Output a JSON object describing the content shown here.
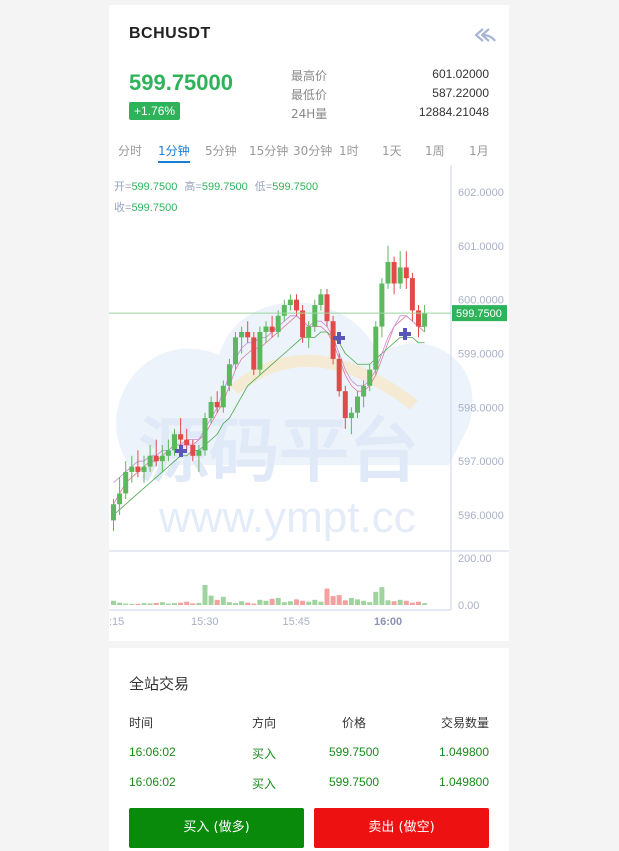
{
  "header": {
    "symbol": "BCHUSDT",
    "price": "599.75000",
    "change_pct": "+1.76%",
    "stats": [
      {
        "label": "最高价",
        "value": "601.02000"
      },
      {
        "label": "最低价",
        "value": "587.22000"
      },
      {
        "label": "24H量",
        "value": "12884.21048"
      }
    ]
  },
  "tabs": [
    {
      "label": "分时",
      "active": false
    },
    {
      "label": "1分钟",
      "active": true
    },
    {
      "label": "5分钟",
      "active": false
    },
    {
      "label": "15分钟",
      "active": false
    },
    {
      "label": "30分钟",
      "active": false
    },
    {
      "label": "1时",
      "active": false
    },
    {
      "label": "1天",
      "active": false
    },
    {
      "label": "1周",
      "active": false
    },
    {
      "label": "1月",
      "active": false
    }
  ],
  "ohlc": {
    "open_label": "开=",
    "open_value": "599.7500",
    "high_label": "高=",
    "high_value": "599.7500",
    "low_label": "低=",
    "low_value": "599.7500",
    "close_label": "收=",
    "close_value": "599.7500"
  },
  "watermark": {
    "line1": "源码平台",
    "line2": "www.ympt.cc"
  },
  "chart_data": {
    "type": "candlestick",
    "price_ticks": [
      "602.0000",
      "601.0000",
      "600.0000",
      "599.0000",
      "598.0000",
      "597.0000",
      "596.0000"
    ],
    "price_tick_values": [
      602,
      601,
      600,
      599,
      598,
      597,
      596
    ],
    "current_price_label": "599.7500",
    "current_price": 599.75,
    "volume_ticks": [
      "200.00",
      "0.00"
    ],
    "volume_tick_values": [
      200,
      0
    ],
    "time_ticks": [
      ":15",
      "15:30",
      "15:45",
      "16:00"
    ],
    "time_tick_index": [
      0,
      15,
      30,
      45
    ],
    "colors": {
      "up": "#5cb85c",
      "down": "#e24a4a",
      "vol_up": "#9fd49f",
      "vol_down": "#f2a0a0"
    },
    "candles": [
      {
        "o": 595.9,
        "h": 596.3,
        "l": 595.7,
        "c": 596.2
      },
      {
        "o": 596.2,
        "h": 596.7,
        "l": 596.0,
        "c": 596.4
      },
      {
        "o": 596.4,
        "h": 597.0,
        "l": 596.3,
        "c": 596.8
      },
      {
        "o": 596.8,
        "h": 597.1,
        "l": 596.6,
        "c": 596.9
      },
      {
        "o": 596.9,
        "h": 597.2,
        "l": 596.7,
        "c": 596.8
      },
      {
        "o": 596.8,
        "h": 597.1,
        "l": 596.6,
        "c": 596.9
      },
      {
        "o": 596.9,
        "h": 597.3,
        "l": 596.8,
        "c": 597.1
      },
      {
        "o": 597.1,
        "h": 597.4,
        "l": 596.9,
        "c": 597.0
      },
      {
        "o": 597.0,
        "h": 597.3,
        "l": 596.8,
        "c": 597.1
      },
      {
        "o": 597.1,
        "h": 597.4,
        "l": 597.0,
        "c": 597.2
      },
      {
        "o": 597.2,
        "h": 597.6,
        "l": 597.1,
        "c": 597.5
      },
      {
        "o": 597.5,
        "h": 597.8,
        "l": 597.3,
        "c": 597.4
      },
      {
        "o": 597.4,
        "h": 597.6,
        "l": 597.2,
        "c": 597.3
      },
      {
        "o": 597.3,
        "h": 597.4,
        "l": 597.0,
        "c": 597.1
      },
      {
        "o": 597.1,
        "h": 597.3,
        "l": 596.8,
        "c": 597.2
      },
      {
        "o": 597.2,
        "h": 597.9,
        "l": 597.1,
        "c": 597.8
      },
      {
        "o": 597.8,
        "h": 598.2,
        "l": 597.7,
        "c": 598.1
      },
      {
        "o": 598.1,
        "h": 598.3,
        "l": 597.9,
        "c": 598.0
      },
      {
        "o": 598.0,
        "h": 598.5,
        "l": 597.9,
        "c": 598.4
      },
      {
        "o": 598.4,
        "h": 598.9,
        "l": 598.3,
        "c": 598.8
      },
      {
        "o": 598.8,
        "h": 599.4,
        "l": 598.7,
        "c": 599.3
      },
      {
        "o": 599.3,
        "h": 599.5,
        "l": 599.0,
        "c": 599.4
      },
      {
        "o": 599.4,
        "h": 599.6,
        "l": 599.2,
        "c": 599.3
      },
      {
        "o": 599.3,
        "h": 599.4,
        "l": 598.6,
        "c": 598.7
      },
      {
        "o": 598.7,
        "h": 599.5,
        "l": 598.6,
        "c": 599.4
      },
      {
        "o": 599.4,
        "h": 599.6,
        "l": 599.2,
        "c": 599.5
      },
      {
        "o": 599.5,
        "h": 599.7,
        "l": 599.3,
        "c": 599.4
      },
      {
        "o": 599.4,
        "h": 599.8,
        "l": 599.3,
        "c": 599.7
      },
      {
        "o": 599.7,
        "h": 600.0,
        "l": 599.6,
        "c": 599.9
      },
      {
        "o": 599.9,
        "h": 600.1,
        "l": 599.8,
        "c": 600.0
      },
      {
        "o": 600.0,
        "h": 600.1,
        "l": 599.7,
        "c": 599.8
      },
      {
        "o": 599.8,
        "h": 599.9,
        "l": 599.2,
        "c": 599.3
      },
      {
        "o": 599.3,
        "h": 599.6,
        "l": 599.1,
        "c": 599.5
      },
      {
        "o": 599.5,
        "h": 600.0,
        "l": 599.4,
        "c": 599.9
      },
      {
        "o": 599.9,
        "h": 600.2,
        "l": 599.8,
        "c": 600.1
      },
      {
        "o": 600.1,
        "h": 600.2,
        "l": 599.5,
        "c": 599.6
      },
      {
        "o": 599.6,
        "h": 599.7,
        "l": 598.8,
        "c": 598.9
      },
      {
        "o": 598.9,
        "h": 599.0,
        "l": 598.2,
        "c": 598.3
      },
      {
        "o": 598.3,
        "h": 598.4,
        "l": 597.6,
        "c": 597.8
      },
      {
        "o": 597.8,
        "h": 598.0,
        "l": 597.5,
        "c": 597.9
      },
      {
        "o": 597.9,
        "h": 598.3,
        "l": 597.8,
        "c": 598.2
      },
      {
        "o": 598.2,
        "h": 598.5,
        "l": 598.0,
        "c": 598.4
      },
      {
        "o": 598.4,
        "h": 598.8,
        "l": 598.3,
        "c": 598.7
      },
      {
        "o": 598.7,
        "h": 599.6,
        "l": 598.6,
        "c": 599.5
      },
      {
        "o": 599.5,
        "h": 600.4,
        "l": 599.3,
        "c": 600.3
      },
      {
        "o": 600.3,
        "h": 601.0,
        "l": 600.2,
        "c": 600.7
      },
      {
        "o": 600.7,
        "h": 600.8,
        "l": 600.1,
        "c": 600.3
      },
      {
        "o": 600.3,
        "h": 600.9,
        "l": 600.2,
        "c": 600.6
      },
      {
        "o": 600.6,
        "h": 600.9,
        "l": 600.2,
        "c": 600.4
      },
      {
        "o": 600.4,
        "h": 600.5,
        "l": 599.6,
        "c": 599.8
      },
      {
        "o": 599.8,
        "h": 599.9,
        "l": 599.3,
        "c": 599.5
      },
      {
        "o": 599.5,
        "h": 599.9,
        "l": 599.4,
        "c": 599.75
      }
    ],
    "volumes": [
      18,
      10,
      6,
      4,
      5,
      8,
      7,
      9,
      12,
      6,
      8,
      10,
      14,
      7,
      9,
      85,
      40,
      22,
      35,
      12,
      8,
      16,
      10,
      6,
      22,
      18,
      26,
      30,
      12,
      16,
      24,
      18,
      14,
      22,
      14,
      70,
      38,
      42,
      20,
      30,
      24,
      18,
      12,
      56,
      76,
      20,
      16,
      22,
      18,
      10,
      14,
      8
    ],
    "ma_fast": [
      596.2,
      596.4,
      596.6,
      596.7,
      596.8,
      596.9,
      597.0,
      597.0,
      597.1,
      597.2,
      597.3,
      597.3,
      597.3,
      597.3,
      597.4,
      597.5,
      597.7,
      597.9,
      598.1,
      598.4,
      598.7,
      598.9,
      599.0,
      599.1,
      599.1,
      599.2,
      599.3,
      599.4,
      599.5,
      599.6,
      599.7,
      599.6,
      599.5,
      599.5,
      599.5,
      599.4,
      599.2,
      598.9,
      598.6,
      598.4,
      598.3,
      598.3,
      598.4,
      598.6,
      598.9,
      599.2,
      599.5,
      599.6,
      599.7,
      599.6,
      599.5,
      599.4
    ],
    "ma_slow": [
      596.0,
      596.1,
      596.2,
      596.3,
      596.4,
      596.5,
      596.6,
      596.7,
      596.8,
      596.9,
      597.0,
      597.1,
      597.1,
      597.2,
      597.2,
      597.3,
      597.4,
      597.5,
      597.7,
      597.8,
      598.0,
      598.2,
      598.4,
      598.5,
      598.6,
      598.7,
      598.8,
      598.9,
      599.0,
      599.1,
      599.2,
      599.3,
      599.3,
      599.3,
      599.4,
      599.4,
      599.3,
      599.2,
      599.0,
      598.9,
      598.8,
      598.8,
      598.8,
      598.9,
      599.0,
      599.1,
      599.2,
      599.3,
      599.3,
      599.3,
      599.2,
      599.2
    ],
    "ma_alt": [
      596.6,
      596.7,
      596.8,
      596.9,
      597.0,
      597.0,
      597.1,
      597.1,
      597.2,
      597.2,
      597.3,
      597.3,
      597.4,
      597.4,
      597.4,
      597.6,
      597.8,
      598.0,
      598.3,
      598.6,
      598.9,
      599.1,
      599.2,
      599.2,
      599.3,
      599.3,
      599.4,
      599.5,
      599.6,
      599.7,
      599.7,
      599.6,
      599.5,
      599.6,
      599.6,
      599.5,
      599.3,
      599.0,
      598.7,
      598.5,
      598.4,
      598.4,
      598.5,
      598.7,
      599.0,
      599.3,
      599.5,
      599.7,
      599.7,
      599.6,
      599.5,
      599.5
    ]
  },
  "trades": {
    "title": "全站交易",
    "headers": [
      "时间",
      "方向",
      "价格",
      "交易数量"
    ],
    "rows": [
      {
        "time": "16:06:02",
        "side": "买入",
        "price": "599.7500",
        "qty": "1.049800"
      },
      {
        "time": "16:06:02",
        "side": "买入",
        "price": "599.7500",
        "qty": "1.049800"
      }
    ]
  },
  "actions": {
    "buy_label": "买入 (做多)",
    "sell_label": "卖出 (做空)",
    "buy_color": "#0a8a0a",
    "sell_color": "#ee1111"
  }
}
